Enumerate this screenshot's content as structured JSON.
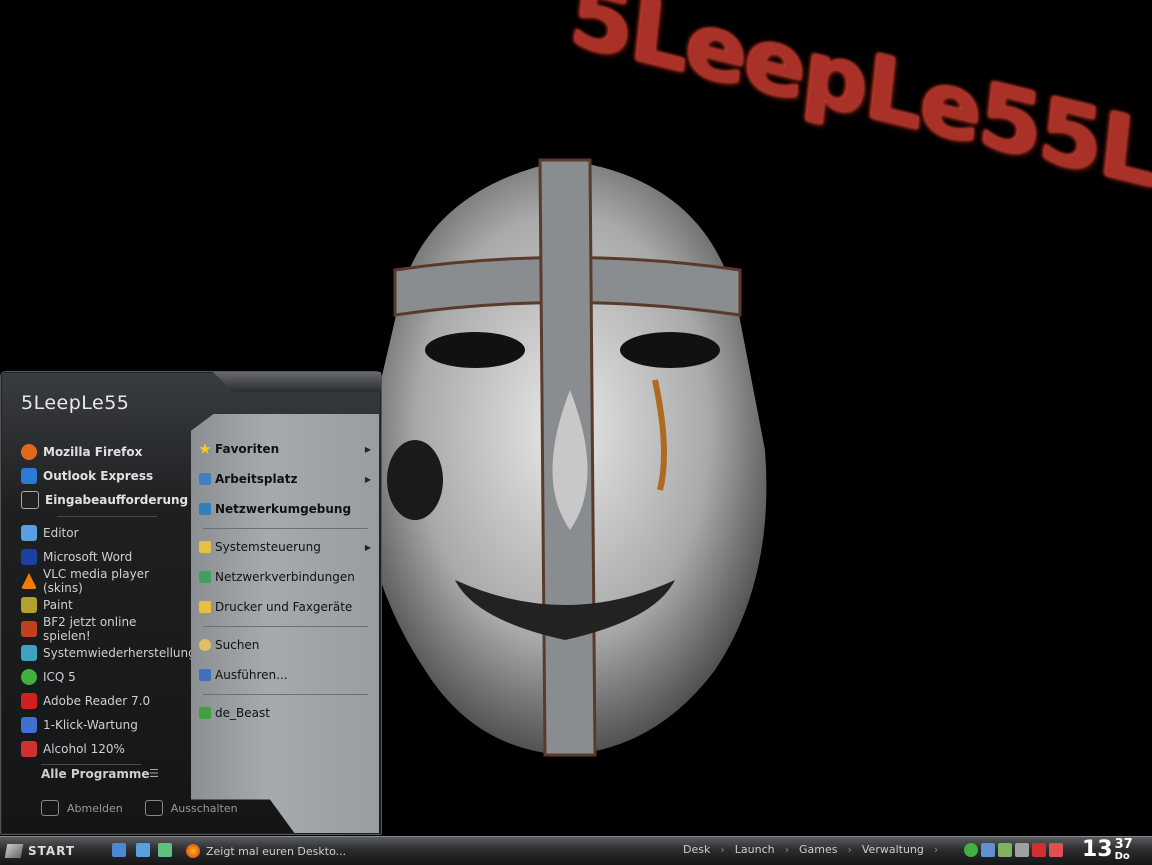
{
  "wallpaper": {
    "title": "5LeepLe55L"
  },
  "start_menu": {
    "user_name": "5LeepLe55",
    "pinned": [
      {
        "label": "Mozilla Firefox",
        "icon": "firefox-icon",
        "color": "#e06a1a"
      },
      {
        "label": "Outlook Express",
        "icon": "outlook-icon",
        "color": "#2e7bd6"
      },
      {
        "label": "Eingabeaufforderung",
        "icon": "cmd-icon",
        "color": "#222222"
      }
    ],
    "recent": [
      {
        "label": "Editor",
        "icon": "notepad-icon",
        "color": "#5aa0e0"
      },
      {
        "label": "Microsoft Word",
        "icon": "word-icon",
        "color": "#1d3fa0"
      },
      {
        "label": "VLC media player (skins)",
        "icon": "vlc-icon",
        "color": "#f07d00"
      },
      {
        "label": "Paint",
        "icon": "paint-icon",
        "color": "#b4a030"
      },
      {
        "label": "BF2 jetzt online spielen!",
        "icon": "bf2-icon",
        "color": "#c04020"
      },
      {
        "label": "Systemwiederherstellung",
        "icon": "restore-icon",
        "color": "#40a0c0"
      },
      {
        "label": "ICQ 5",
        "icon": "icq-icon",
        "color": "#40b040"
      },
      {
        "label": "Adobe Reader 7.0",
        "icon": "adobe-icon",
        "color": "#d02020"
      },
      {
        "label": "1-Klick-Wartung",
        "icon": "maintenance-icon",
        "color": "#4070d0"
      },
      {
        "label": "Alcohol 120%",
        "icon": "alcohol-icon",
        "color": "#d03030"
      }
    ],
    "all_programs": "Alle Programme",
    "all_programs_arrow": "☰",
    "logoff": "Abmelden",
    "shutdown": "Ausschalten",
    "right": [
      {
        "label": "Favoriten",
        "icon": "star-icon",
        "color": "#f0d020",
        "bold": true,
        "arrow": "▶"
      },
      {
        "label": "Arbeitsplatz",
        "icon": "computer-icon",
        "color": "#4080c0",
        "bold": true,
        "arrow": "▶"
      },
      {
        "label": "Netzwerkumgebung",
        "icon": "network-icon",
        "color": "#3080c0",
        "bold": true,
        "arrow": ""
      },
      {
        "label": "Systemsteuerung",
        "icon": "folder-icon",
        "color": "#e8c040",
        "bold": false,
        "arrow": "▶"
      },
      {
        "label": "Netzwerkverbindungen",
        "icon": "network-connections-icon",
        "color": "#40a060",
        "bold": false,
        "arrow": ""
      },
      {
        "label": "Drucker und Faxgeräte",
        "icon": "printer-folder-icon",
        "color": "#e8c040",
        "bold": false,
        "arrow": ""
      },
      {
        "label": "Suchen",
        "icon": "search-icon",
        "color": "#e0c060",
        "bold": false,
        "arrow": ""
      },
      {
        "label": "Ausführen...",
        "icon": "run-icon",
        "color": "#4070c0",
        "bold": false,
        "arrow": ""
      },
      {
        "label": "de_Beast",
        "icon": "user-icon",
        "color": "#40a040",
        "bold": false,
        "arrow": ""
      }
    ]
  },
  "taskbar": {
    "start_label": "START",
    "task": "Zeigt mal euren Deskto...",
    "links": [
      "Desk",
      "Launch",
      "Games",
      "Verwaltung"
    ],
    "link_sep": "›",
    "clock_hour": "13",
    "clock_minute": "37",
    "clock_day": "Do"
  }
}
